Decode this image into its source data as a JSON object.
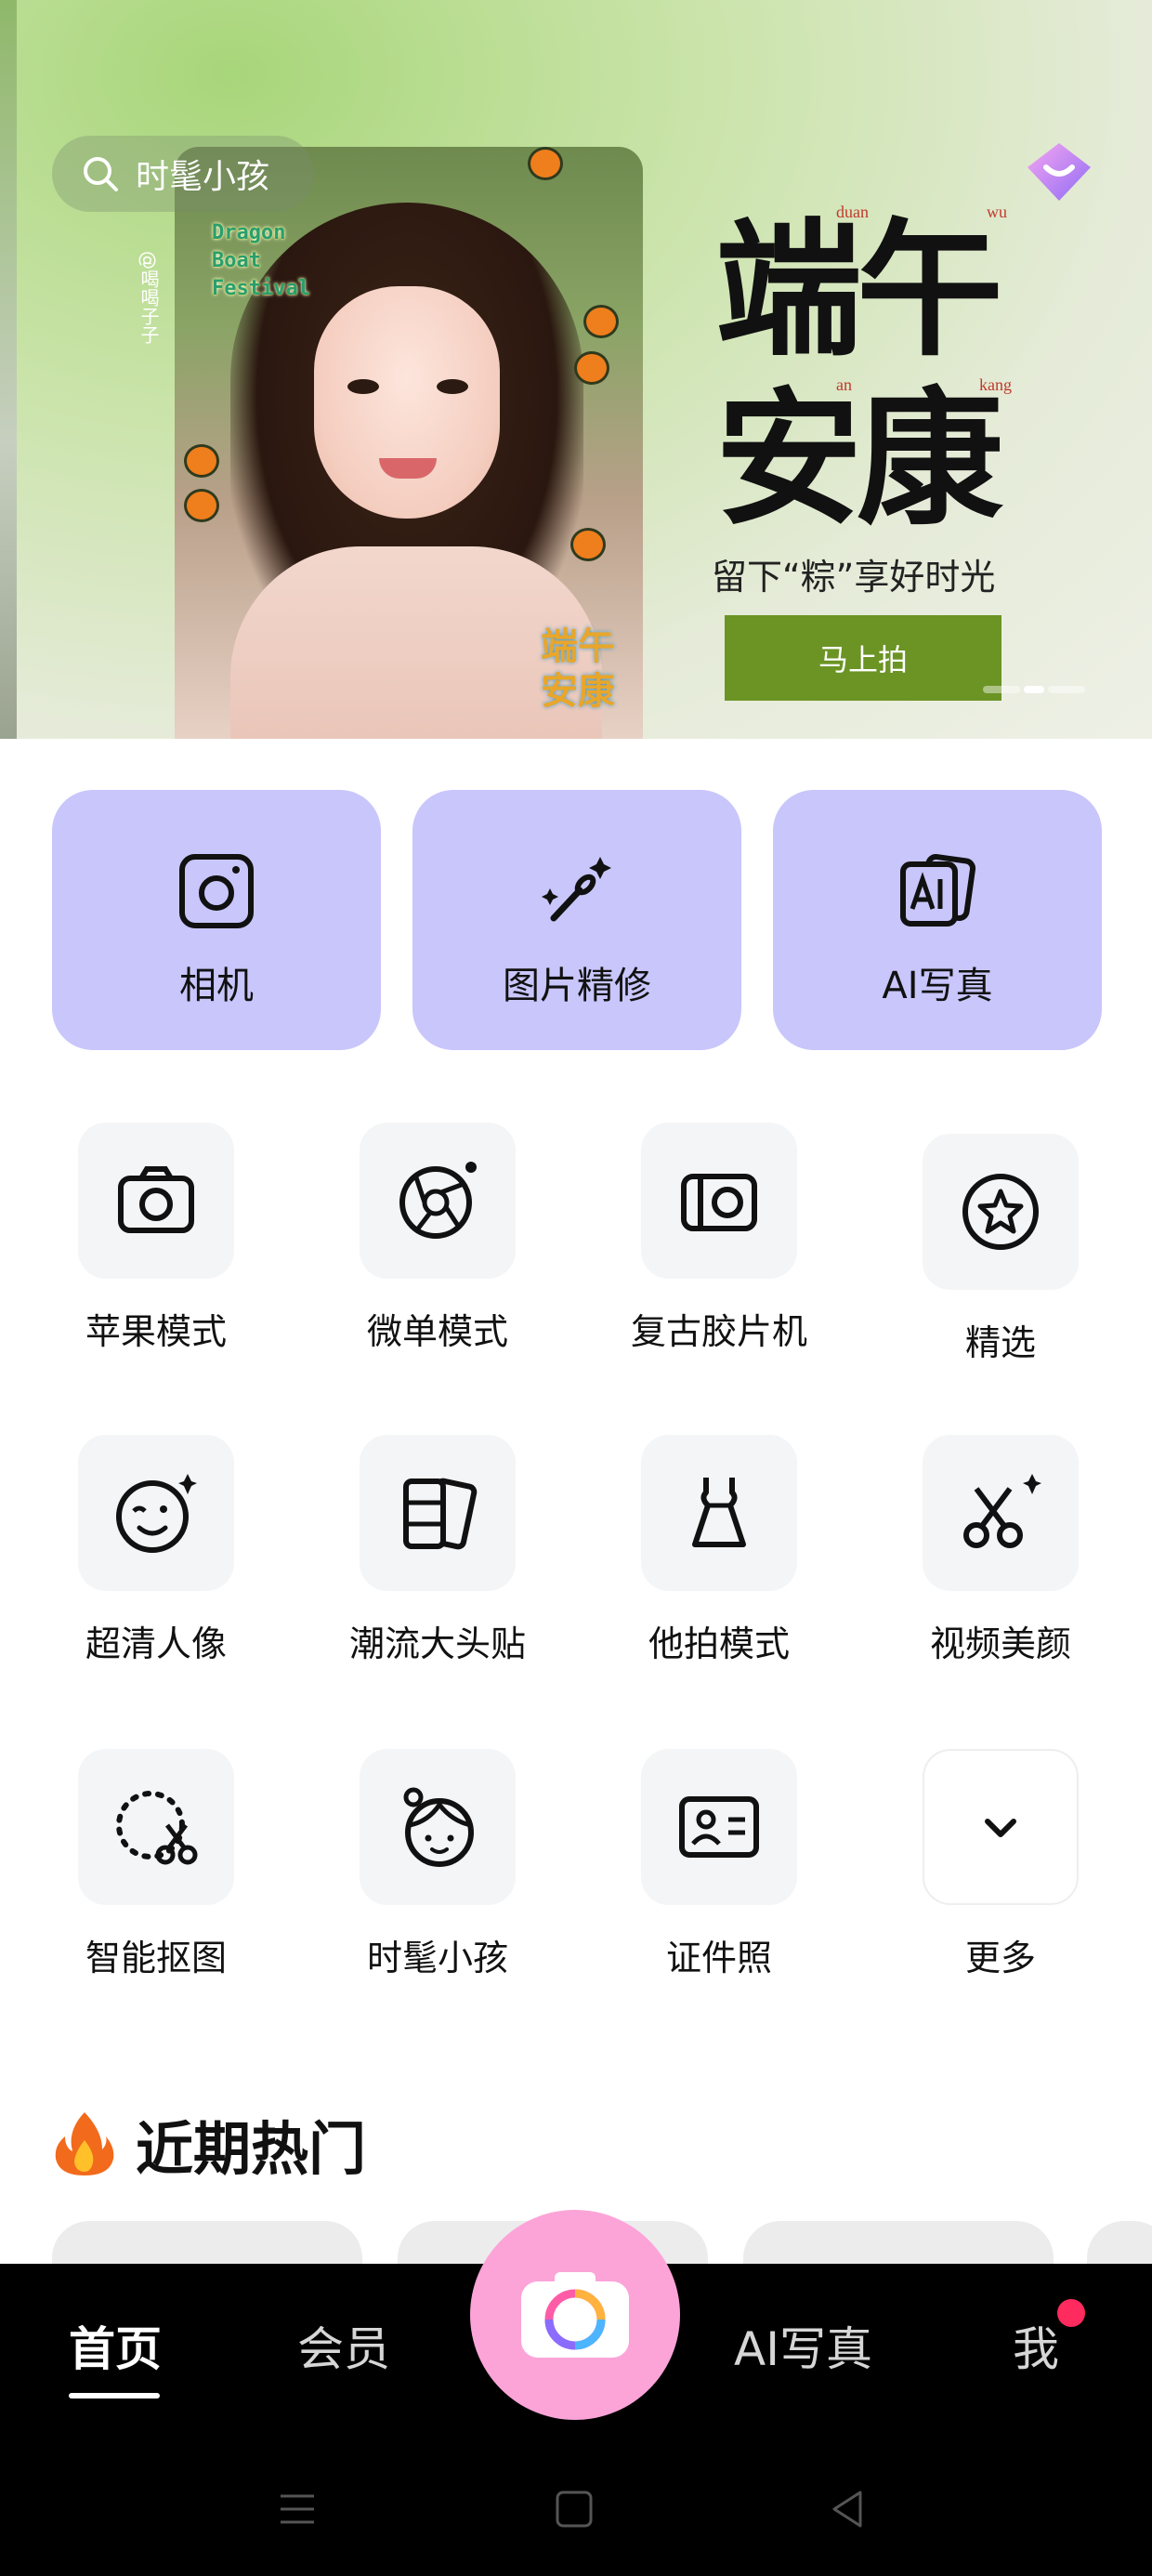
{
  "banner": {
    "search_text": "时髦小孩",
    "title_line1": "端午",
    "title_line2": "安康",
    "pinyin": [
      "duan",
      "wu",
      "an",
      "kang"
    ],
    "subtitle": "留下“粽”享好时光",
    "cta_label": "马上拍",
    "photo_sticker_en": [
      "Dragon",
      "Boat",
      "Festival"
    ],
    "photo_sticker_cn": [
      "端午",
      "安康"
    ],
    "photo_author": "@喝喝子子",
    "pager_count": 3,
    "pager_active": 2
  },
  "features": [
    {
      "label": "相机",
      "icon": "camera-square-icon"
    },
    {
      "label": "图片精修",
      "icon": "magic-wand-icon"
    },
    {
      "label": "AI写真",
      "icon": "ai-photo-icon"
    }
  ],
  "tools": [
    {
      "label": "苹果模式",
      "icon": "camera-icon"
    },
    {
      "label": "微单模式",
      "icon": "aperture-icon"
    },
    {
      "label": "复古胶片机",
      "icon": "film-camera-icon"
    },
    {
      "label": "精选",
      "icon": "star-badge-icon"
    },
    {
      "label": "超清人像",
      "icon": "face-wink-icon"
    },
    {
      "label": "潮流大头贴",
      "icon": "photo-sticker-icon"
    },
    {
      "label": "他拍模式",
      "icon": "dress-icon"
    },
    {
      "label": "视频美颜",
      "icon": "scissors-sparkle-icon"
    },
    {
      "label": "智能抠图",
      "icon": "cutout-icon"
    },
    {
      "label": "时髦小孩",
      "icon": "kid-face-icon"
    },
    {
      "label": "证件照",
      "icon": "id-card-icon"
    },
    {
      "label": "更多",
      "icon": "chevron-down-icon"
    }
  ],
  "recent": {
    "title": "近期热门"
  },
  "nav": {
    "home": "首页",
    "member": "会员",
    "ai_photo": "AI写真",
    "me": "我"
  },
  "colors": {
    "feature_bg": "#c8c6fb",
    "cta_green": "#6b9424",
    "fab_pink": "#fca4d8",
    "badge_red": "#ff2a5e"
  }
}
